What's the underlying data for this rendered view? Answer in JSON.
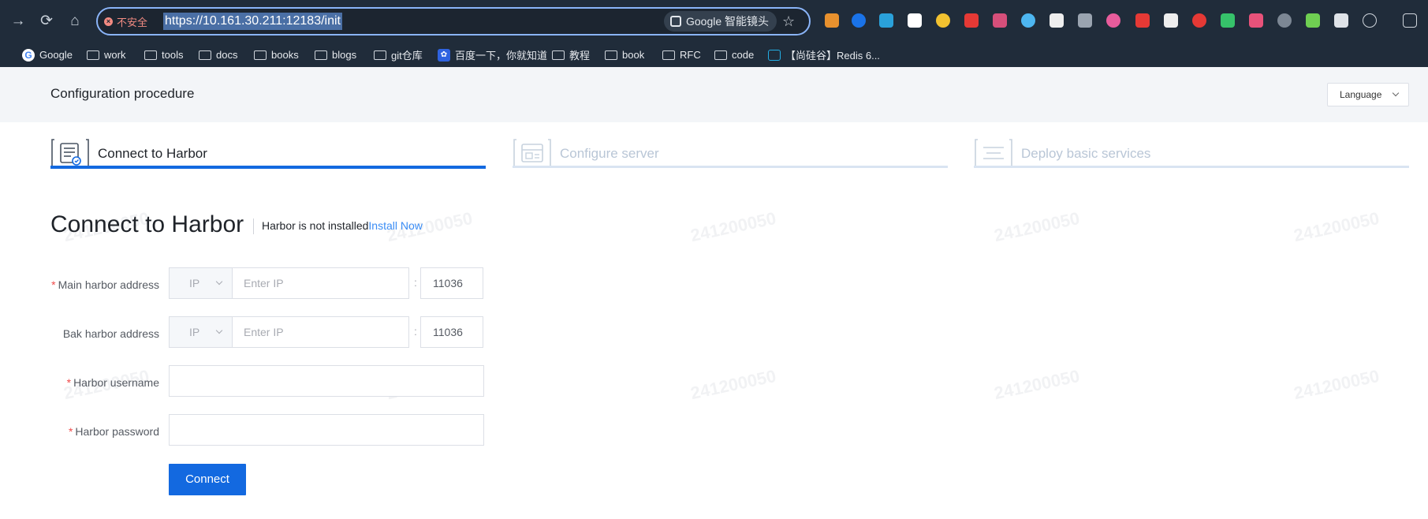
{
  "browser": {
    "nav": {
      "back_icon": "→",
      "reload_icon": "⟳",
      "home_icon": "⌂"
    },
    "security_label": "不安全",
    "url": "https://10.161.30.211:12183/init",
    "lens_label": "Google 智能镜头",
    "star_icon": "☆",
    "extensions": [
      {
        "name": "bookmark-ext-icon",
        "color": "#e8912e"
      },
      {
        "name": "drive-ext-icon",
        "color": "#1a73e8"
      },
      {
        "name": "telegram-ext-icon",
        "color": "#2aa1da"
      },
      {
        "name": "ring-ext-icon",
        "color": "#ffffff"
      },
      {
        "name": "highlighter-ext-icon",
        "color": "#f2c230"
      },
      {
        "name": "adblock-ext-icon",
        "color": "#e53935"
      },
      {
        "name": "puzzle-ext-icon",
        "color": "#d64f7a"
      },
      {
        "name": "save-ext-icon",
        "color": "#4db6f0"
      },
      {
        "name": "reader-ext-icon",
        "color": "#eeeeee"
      },
      {
        "name": "avatar-ext-icon",
        "color": "#9aa4b0"
      },
      {
        "name": "color-grid-ext-icon",
        "color": "#e85c9c"
      },
      {
        "name": "red-box-ext-icon",
        "color": "#e53935"
      },
      {
        "name": "eyes-ext-icon",
        "color": "#eeeeee"
      },
      {
        "name": "pdf-ext-icon",
        "color": "#e53935"
      },
      {
        "name": "green-dots-ext-icon",
        "color": "#36c26a"
      },
      {
        "name": "translate-ext-icon",
        "color": "#e8527a"
      },
      {
        "name": "copy-ext-icon",
        "color": "#7c8794"
      },
      {
        "name": "leaf-ext-icon",
        "color": "#6fcf52"
      },
      {
        "name": "shield-ext-icon",
        "color": "#dfe3e8"
      },
      {
        "name": "extensions-puzzle-icon",
        "color": "#cfd5dc"
      },
      {
        "name": "download-icon",
        "color": "#cfd5dc"
      }
    ],
    "bookmarks": [
      {
        "label": "Google",
        "icon": "google-icon"
      },
      {
        "label": "work",
        "icon": "folder-icon"
      },
      {
        "label": "tools",
        "icon": "folder-icon"
      },
      {
        "label": "docs",
        "icon": "folder-icon"
      },
      {
        "label": "books",
        "icon": "folder-icon"
      },
      {
        "label": "blogs",
        "icon": "folder-icon"
      },
      {
        "label": "git仓库",
        "icon": "folder-icon"
      },
      {
        "label": "百度一下，你就知道",
        "icon": "baidu-paw-icon"
      },
      {
        "label": "教程",
        "icon": "folder-icon"
      },
      {
        "label": "book",
        "icon": "folder-icon"
      },
      {
        "label": "RFC",
        "icon": "folder-icon"
      },
      {
        "label": "code",
        "icon": "folder-icon"
      },
      {
        "label": "【尚硅谷】Redis 6...",
        "icon": "bilibili-tv-icon"
      }
    ]
  },
  "page": {
    "title": "Configuration procedure",
    "language_label": "Language",
    "steps": [
      {
        "label": "Connect to Harbor",
        "state": "active"
      },
      {
        "label": "Configure server",
        "state": "inactive"
      },
      {
        "label": "Deploy basic services",
        "state": "inactive"
      }
    ],
    "section_title": "Connect to Harbor",
    "status_text": "Harbor is not installed",
    "install_link": "Install Now",
    "form": {
      "main_address": {
        "label": "Main harbor address",
        "required": true,
        "type_value": "IP",
        "ip_placeholder": "Enter IP",
        "colon": ":",
        "port": "11036"
      },
      "bak_address": {
        "label": "Bak harbor address",
        "required": false,
        "type_value": "IP",
        "ip_placeholder": "Enter IP",
        "colon": ":",
        "port": "11036"
      },
      "username": {
        "label": "Harbor username",
        "required": true,
        "value": ""
      },
      "password": {
        "label": "Harbor password",
        "required": true,
        "value": ""
      },
      "connect_label": "Connect"
    },
    "watermark_text": "241200050",
    "colors": {
      "accent": "#1369e0",
      "link": "#3b8df5",
      "required": "#f04b4b"
    }
  }
}
